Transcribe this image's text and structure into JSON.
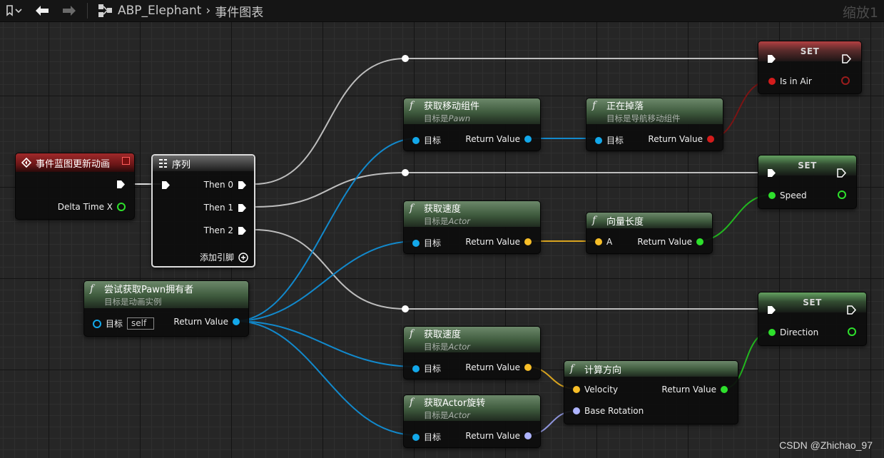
{
  "toolbar": {
    "bookmark_icon": "bookmark-icon",
    "back_icon": "arrow-left-icon",
    "forward_icon": "arrow-right-icon",
    "breadcrumb": [
      "ABP_Elephant",
      "事件图表"
    ],
    "zoom_label": "缩放1"
  },
  "nodes": {
    "event": {
      "title": "事件蓝图更新动画",
      "pin_delta": "Delta Time X"
    },
    "sequence": {
      "title": "序列",
      "then0": "Then 0",
      "then1": "Then 1",
      "then2": "Then 2",
      "add_pin": "添加引脚"
    },
    "try_get_pawn": {
      "title": "尝试获取Pawn拥有者",
      "subtitle": "目标是动画实例",
      "pin_target": "目标",
      "self_value": "self",
      "pin_return": "Return Value"
    },
    "get_movement": {
      "title": "获取移动组件",
      "subtitle_prefix": "目标是",
      "subtitle_class": "Pawn",
      "pin_target": "目标",
      "pin_return": "Return Value"
    },
    "is_falling": {
      "title": "正在掉落",
      "subtitle": "目标是导航移动组件",
      "pin_target": "目标",
      "pin_return": "Return Value"
    },
    "get_velocity1": {
      "title": "获取速度",
      "subtitle_prefix": "目标是",
      "subtitle_class": "Actor",
      "pin_target": "目标",
      "pin_return": "Return Value"
    },
    "vector_length": {
      "title": "向量长度",
      "pin_a": "A",
      "pin_return": "Return Value"
    },
    "get_velocity2": {
      "title": "获取速度",
      "subtitle_prefix": "目标是",
      "subtitle_class": "Actor",
      "pin_target": "目标",
      "pin_return": "Return Value"
    },
    "get_rotation": {
      "title": "获取Actor旋转",
      "subtitle_prefix": "目标是",
      "subtitle_class": "Actor",
      "pin_target": "目标",
      "pin_return": "Return Value"
    },
    "calc_direction": {
      "title": "计算方向",
      "pin_velocity": "Velocity",
      "pin_base_rotation": "Base Rotation",
      "pin_return": "Return Value"
    },
    "set_air": {
      "title": "SET",
      "pin_var": "Is in Air"
    },
    "set_speed": {
      "title": "SET",
      "pin_var": "Speed"
    },
    "set_direction": {
      "title": "SET",
      "pin_var": "Direction"
    }
  },
  "colors": {
    "exec": "#ffffff",
    "object": "#13a8ea",
    "vector": "#f7be28",
    "float": "#2ee02c",
    "bool": "#9a1c1c",
    "rotator": "#aeb4ff"
  },
  "watermark": "CSDN @Zhichao_97"
}
